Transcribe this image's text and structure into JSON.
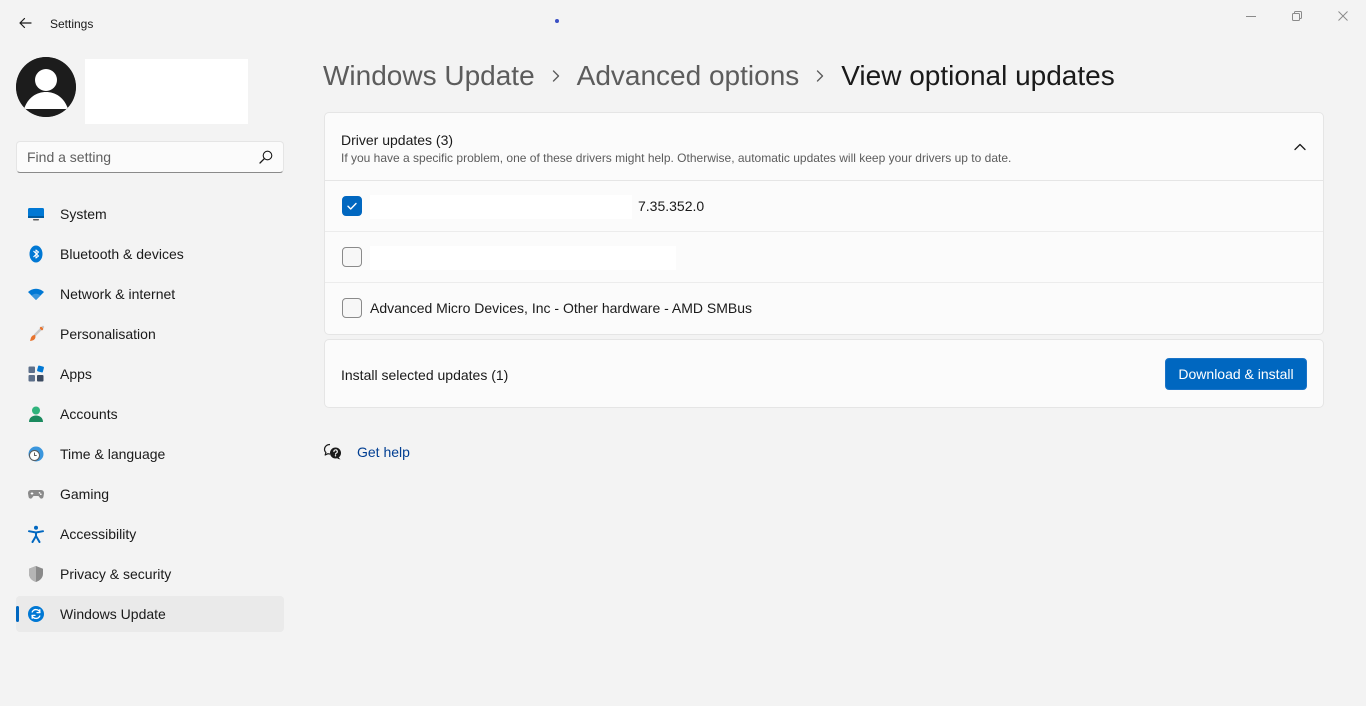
{
  "window": {
    "title": "Settings",
    "controls": {
      "minimize": "minimize-icon",
      "maximize": "maximize-icon",
      "close": "close-icon"
    }
  },
  "search": {
    "placeholder": "Find a setting"
  },
  "sidebar": {
    "items": [
      {
        "label": "System",
        "icon": "monitor-icon"
      },
      {
        "label": "Bluetooth & devices",
        "icon": "bluetooth-icon"
      },
      {
        "label": "Network & internet",
        "icon": "wifi-icon"
      },
      {
        "label": "Personalisation",
        "icon": "brush-icon"
      },
      {
        "label": "Apps",
        "icon": "apps-icon"
      },
      {
        "label": "Accounts",
        "icon": "person-icon"
      },
      {
        "label": "Time & language",
        "icon": "clock-globe-icon"
      },
      {
        "label": "Gaming",
        "icon": "gamepad-icon"
      },
      {
        "label": "Accessibility",
        "icon": "accessibility-icon"
      },
      {
        "label": "Privacy & security",
        "icon": "shield-icon"
      },
      {
        "label": "Windows Update",
        "icon": "update-icon",
        "active": true
      }
    ]
  },
  "breadcrumb": {
    "items": [
      "Windows Update",
      "Advanced options"
    ],
    "current": "View optional updates"
  },
  "drivers": {
    "title": "Driver updates (3)",
    "description": "If you have a specific problem, one of these drivers might help. Otherwise, automatic updates will keep your drivers up to date.",
    "rows": [
      {
        "text": "7.35.352.0",
        "checked": true
      },
      {
        "text": "",
        "checked": false
      },
      {
        "text": "Advanced Micro Devices, Inc - Other hardware - AMD SMBus",
        "checked": false
      }
    ]
  },
  "install": {
    "label": "Install selected updates (1)",
    "button": "Download & install"
  },
  "help": {
    "label": "Get help"
  },
  "colors": {
    "accent": "#0067c0",
    "link": "#003e92",
    "background": "#f3f3f3"
  }
}
